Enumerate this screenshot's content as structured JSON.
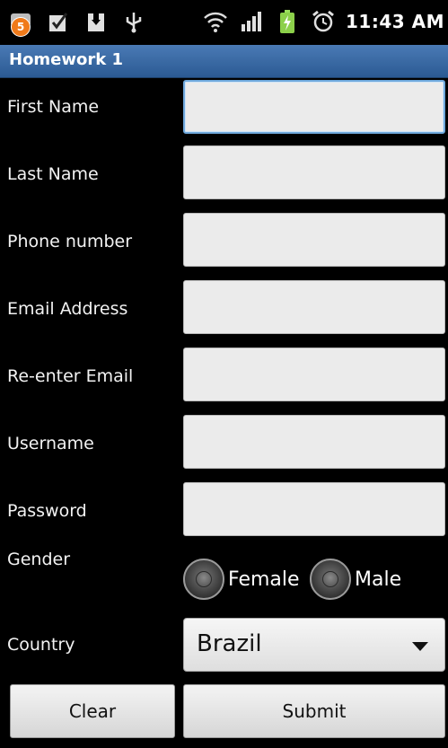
{
  "status_bar": {
    "notification_count": "5",
    "time": "11:43 AM",
    "icons": [
      "notification-icon",
      "checkbox-icon",
      "download-icon",
      "usb-icon",
      "wifi-icon",
      "signal-icon",
      "battery-charging-icon",
      "alarm-icon"
    ]
  },
  "app": {
    "title": "Homework 1"
  },
  "form": {
    "first_name_label": "First Name",
    "first_name_value": "",
    "last_name_label": "Last Name",
    "last_name_value": "",
    "phone_label": "Phone number",
    "phone_value": "",
    "email_label": "Email Address",
    "email_value": "",
    "reemail_label": "Re-enter Email",
    "reemail_value": "",
    "username_label": "Username",
    "username_value": "",
    "password_label": "Password",
    "password_value": "",
    "gender_label": "Gender",
    "gender_options": [
      "Female",
      "Male"
    ],
    "country_label": "Country",
    "country_selected": "Brazil"
  },
  "buttons": {
    "clear": "Clear",
    "submit": "Submit"
  },
  "colors": {
    "title_bar": "#3b6ba5",
    "focus_border": "#6fa8dc",
    "field_bg": "#ebebeb"
  }
}
